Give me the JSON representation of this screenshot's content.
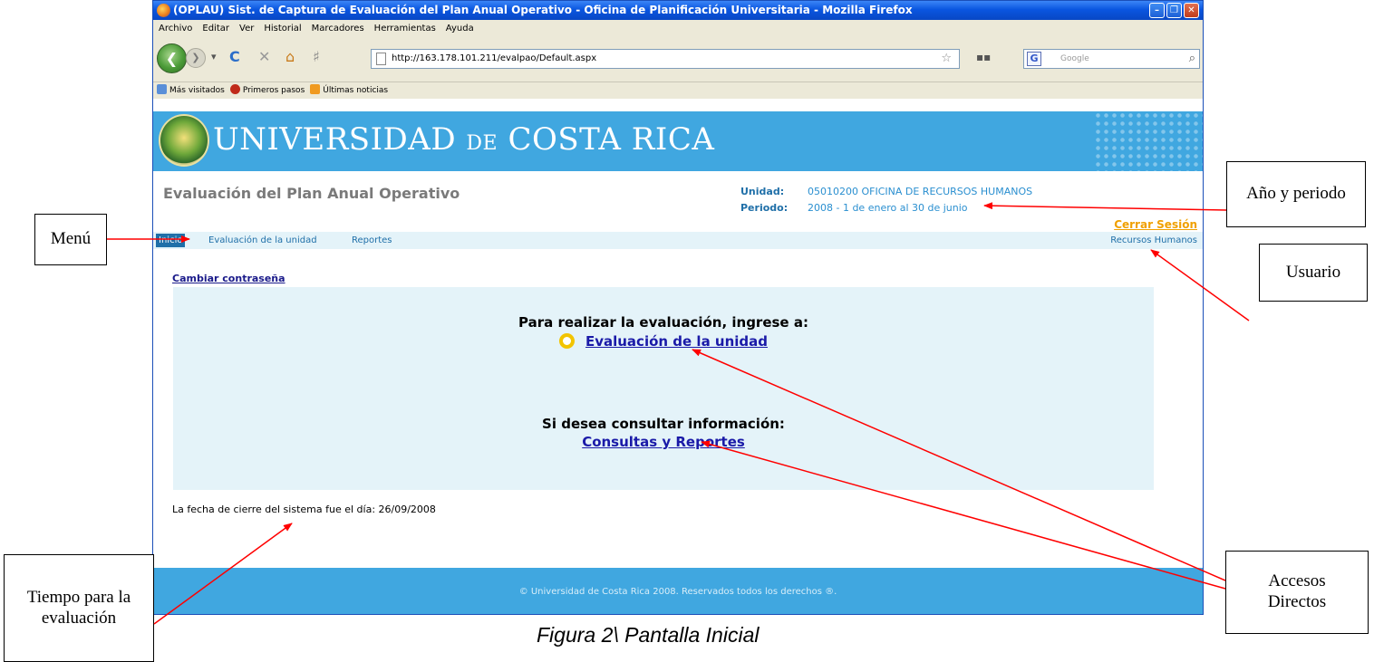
{
  "window": {
    "title": "(OPLAU) Sist. de Captura de Evaluación del Plan Anual Operativo - Oficina de Planificación Universitaria - Mozilla Firefox",
    "menu": [
      "Archivo",
      "Editar",
      "Ver",
      "Historial",
      "Marcadores",
      "Herramientas",
      "Ayuda"
    ],
    "url": "http://163.178.101.211/evalpao/Default.aspx",
    "search_placeholder": "Google",
    "bookmarks": [
      "Más visitados",
      "Primeros pasos",
      "Últimas noticias"
    ]
  },
  "page": {
    "banner_title_1": "UNIVERSIDAD",
    "banner_title_de": "DE",
    "banner_title_2": "COSTA RICA",
    "app_title": "Evaluación del Plan Anual Operativo",
    "unit_label": "Unidad:",
    "unit_value": "05010200 OFICINA DE RECURSOS HUMANOS",
    "period_label": "Periodo:",
    "period_value": "2008 - 1 de enero al 30 de junio",
    "logout": "Cerrar Sesión",
    "nav": {
      "home": "Inicio",
      "item1": "Evaluación de la unidad",
      "item2": "Reportes",
      "user": "Recursos Humanos"
    },
    "change_password": "Cambiar contraseña",
    "panel": {
      "heading1": "Para realizar la evaluación, ingrese a:",
      "link1": "Evaluación de la unidad",
      "heading2": "Si desea consultar información:",
      "link2": "Consultas y Reportes"
    },
    "closing_date": "La fecha de cierre del sistema fue el día: 26/09/2008",
    "footer": "© Universidad de Costa Rica 2008. Reservados todos los derechos ®."
  },
  "callouts": {
    "menu": "Menú",
    "year_period": "Año y periodo",
    "user": "Usuario",
    "shortcuts": "Accesos Directos",
    "time": "Tiempo para la evaluación"
  },
  "caption": "Figura 2\\ Pantalla Inicial",
  "colors": {
    "banner": "#40a7e0",
    "panel": "#e4f3f9",
    "logout": "#f0a000",
    "arrow": "#ff0000"
  }
}
